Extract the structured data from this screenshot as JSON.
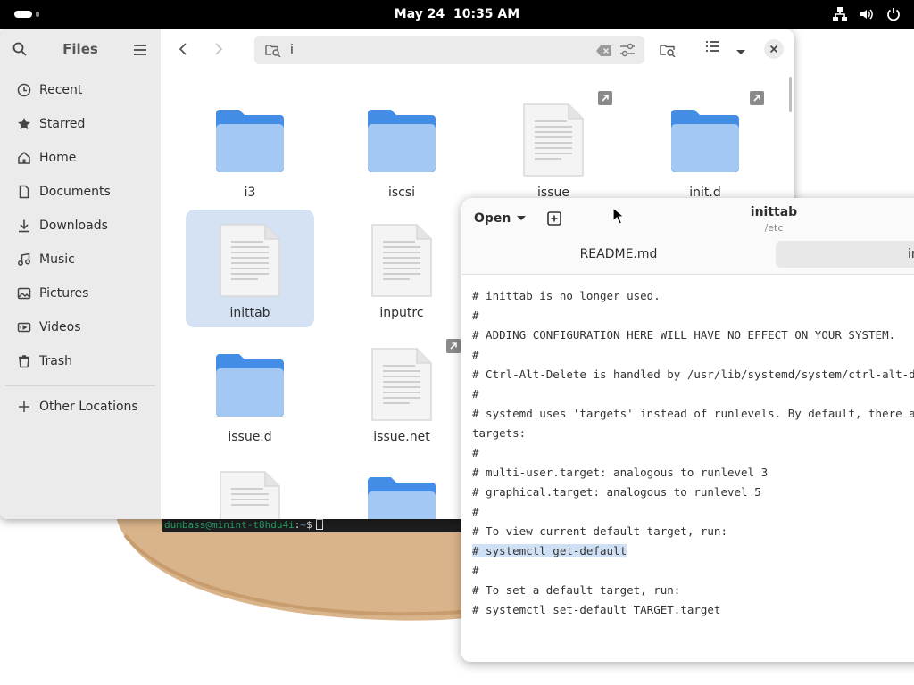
{
  "topbar": {
    "date": "May 24",
    "time": "10:35 AM"
  },
  "terminal": {
    "user_host": "dumbass@minint-t8hdu4i",
    "sep": ":",
    "path": "~",
    "prompt": "$"
  },
  "files": {
    "sidebar": {
      "title": "Files",
      "items": [
        {
          "label": "Recent",
          "icon": "clock-icon"
        },
        {
          "label": "Starred",
          "icon": "star-icon"
        },
        {
          "label": "Home",
          "icon": "home-icon"
        },
        {
          "label": "Documents",
          "icon": "document-icon"
        },
        {
          "label": "Downloads",
          "icon": "download-icon"
        },
        {
          "label": "Music",
          "icon": "music-icon"
        },
        {
          "label": "Pictures",
          "icon": "picture-icon"
        },
        {
          "label": "Videos",
          "icon": "video-icon"
        },
        {
          "label": "Trash",
          "icon": "trash-icon"
        }
      ],
      "other_locations": "Other Locations"
    },
    "search": {
      "value": "i"
    },
    "grid": [
      {
        "name": "i3",
        "type": "folder",
        "selected": false,
        "link": false
      },
      {
        "name": "iscsi",
        "type": "folder",
        "selected": false,
        "link": false
      },
      {
        "name": "issue",
        "type": "file",
        "selected": false,
        "link": true
      },
      {
        "name": "init.d",
        "type": "folder",
        "selected": false,
        "link": true
      },
      {
        "name": "inittab",
        "type": "file",
        "selected": true,
        "link": false
      },
      {
        "name": "inputrc",
        "type": "file",
        "selected": false,
        "link": false
      },
      {
        "name": "issue.d",
        "type": "folder",
        "selected": false,
        "link": false
      },
      {
        "name": "issue.net",
        "type": "file",
        "selected": false,
        "link": false
      }
    ]
  },
  "editor": {
    "open_label": "Open",
    "title": "inittab",
    "subtitle": "/etc",
    "tabs": [
      {
        "label": "README.md",
        "active": false
      },
      {
        "label": "inittab",
        "active": true
      }
    ],
    "lines": [
      "# inittab is no longer used.",
      "#",
      "# ADDING CONFIGURATION HERE WILL HAVE NO EFFECT ON YOUR SYSTEM.",
      "#",
      "# Ctrl-Alt-Delete is handled by /usr/lib/systemd/system/ctrl-alt-del.target",
      "#",
      "# systemd uses 'targets' instead of runlevels. By default, there are two main",
      "targets:",
      "#",
      "# multi-user.target: analogous to runlevel 3",
      "# graphical.target: analogous to runlevel 5",
      "#",
      "# To view current default target, run:",
      "# systemctl get-default",
      "#",
      "# To set a default target, run:",
      "# systemctl set-default TARGET.target"
    ]
  },
  "colors": {
    "topbar": "#000000",
    "folder": "#62a0ea",
    "folder_front": "#99c1f1",
    "selection": "#d4e2f3",
    "highlight": "#cfe0f5",
    "spell_error": "#e01b24",
    "terminal_user": "#26a269"
  }
}
